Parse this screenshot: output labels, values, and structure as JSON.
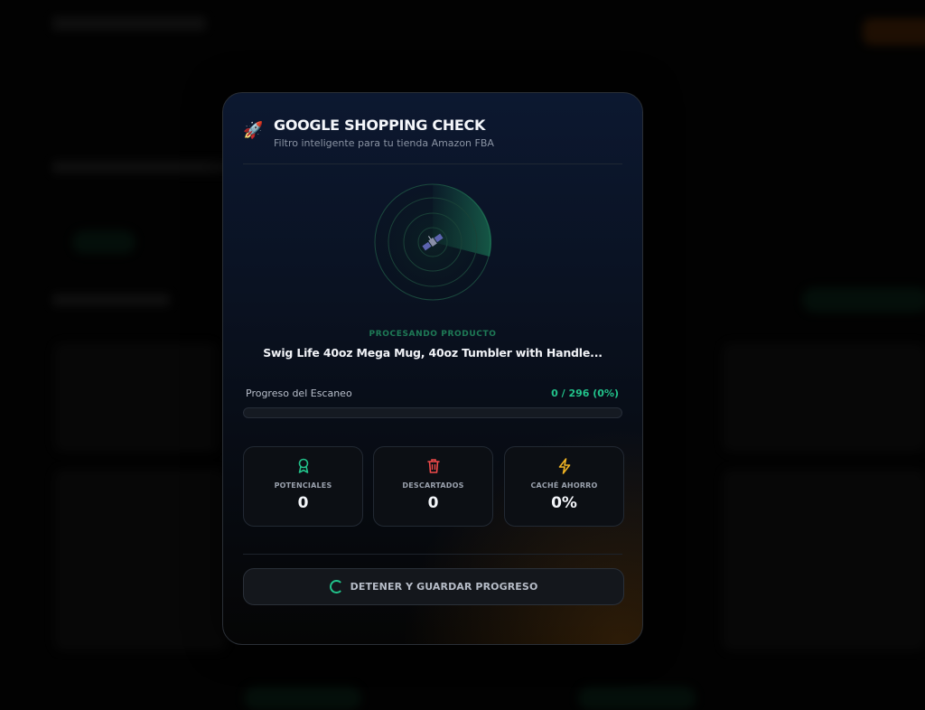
{
  "modal": {
    "icon": "rocket-icon",
    "title": "GOOGLE SHOPPING CHECK",
    "subtitle": "Filtro inteligente para tu tienda Amazon FBA",
    "status_label": "PROCESANDO PRODUCTO",
    "product_name": "Swig Life 40oz Mega Mug, 40oz Tumbler with Handle...",
    "progress": {
      "label": "Progreso del Escaneo",
      "count_text": "0 / 296 (0%)",
      "current": 0,
      "total": 296,
      "fraction": 0.0
    },
    "stats": [
      {
        "label": "POTENCIALES",
        "value": "0",
        "icon": "award-icon",
        "color": "#22c28a"
      },
      {
        "label": "DESCARTADOS",
        "value": "0",
        "icon": "trash-icon",
        "color": "#ef4a4a"
      },
      {
        "label": "CACHÉ AHORRO",
        "value": "0%",
        "icon": "lightning-icon",
        "color": "#f0b323"
      }
    ],
    "stop_button": "DETENER Y GUARDAR PROGRESO"
  },
  "colors": {
    "accent": "#22c28a",
    "danger": "#ef4a4a",
    "warning": "#f0b323"
  }
}
